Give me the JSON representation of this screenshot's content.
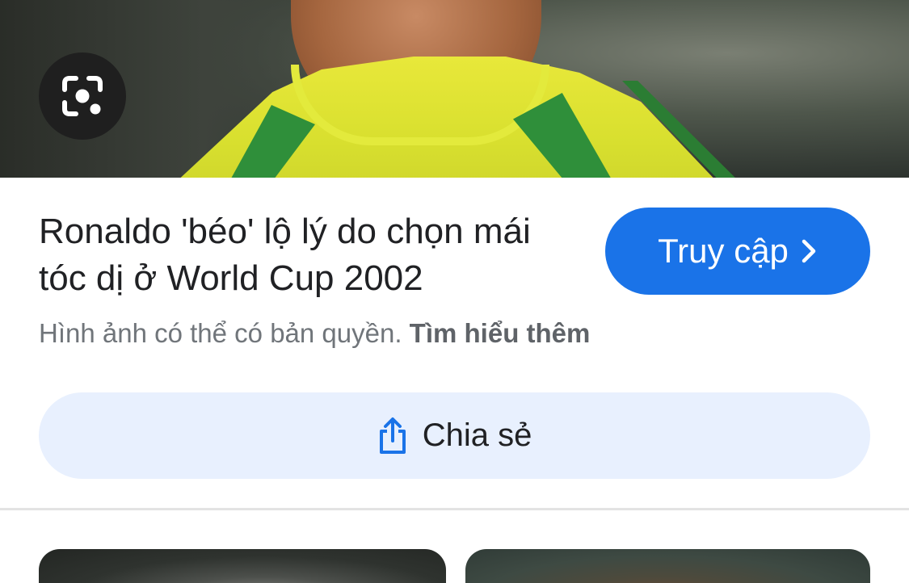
{
  "result": {
    "title": "Ronaldo 'béo' lộ lý do chọn mái tóc dị ở World Cup 2002",
    "visit_label": "Truy cập",
    "copyright_text": "Hình ảnh có thể có bản quyền.",
    "learn_more_label": "Tìm hiểu thêm",
    "share_label": "Chia sẻ"
  },
  "icons": {
    "lens": "google-lens-icon",
    "visit_chevron": "chevron-right-icon",
    "share": "share-icon"
  },
  "colors": {
    "accent": "#1a73e8",
    "share_bg": "#e8f0fe",
    "lens_bg": "#1f1f1f",
    "muted_text": "#70757a"
  }
}
